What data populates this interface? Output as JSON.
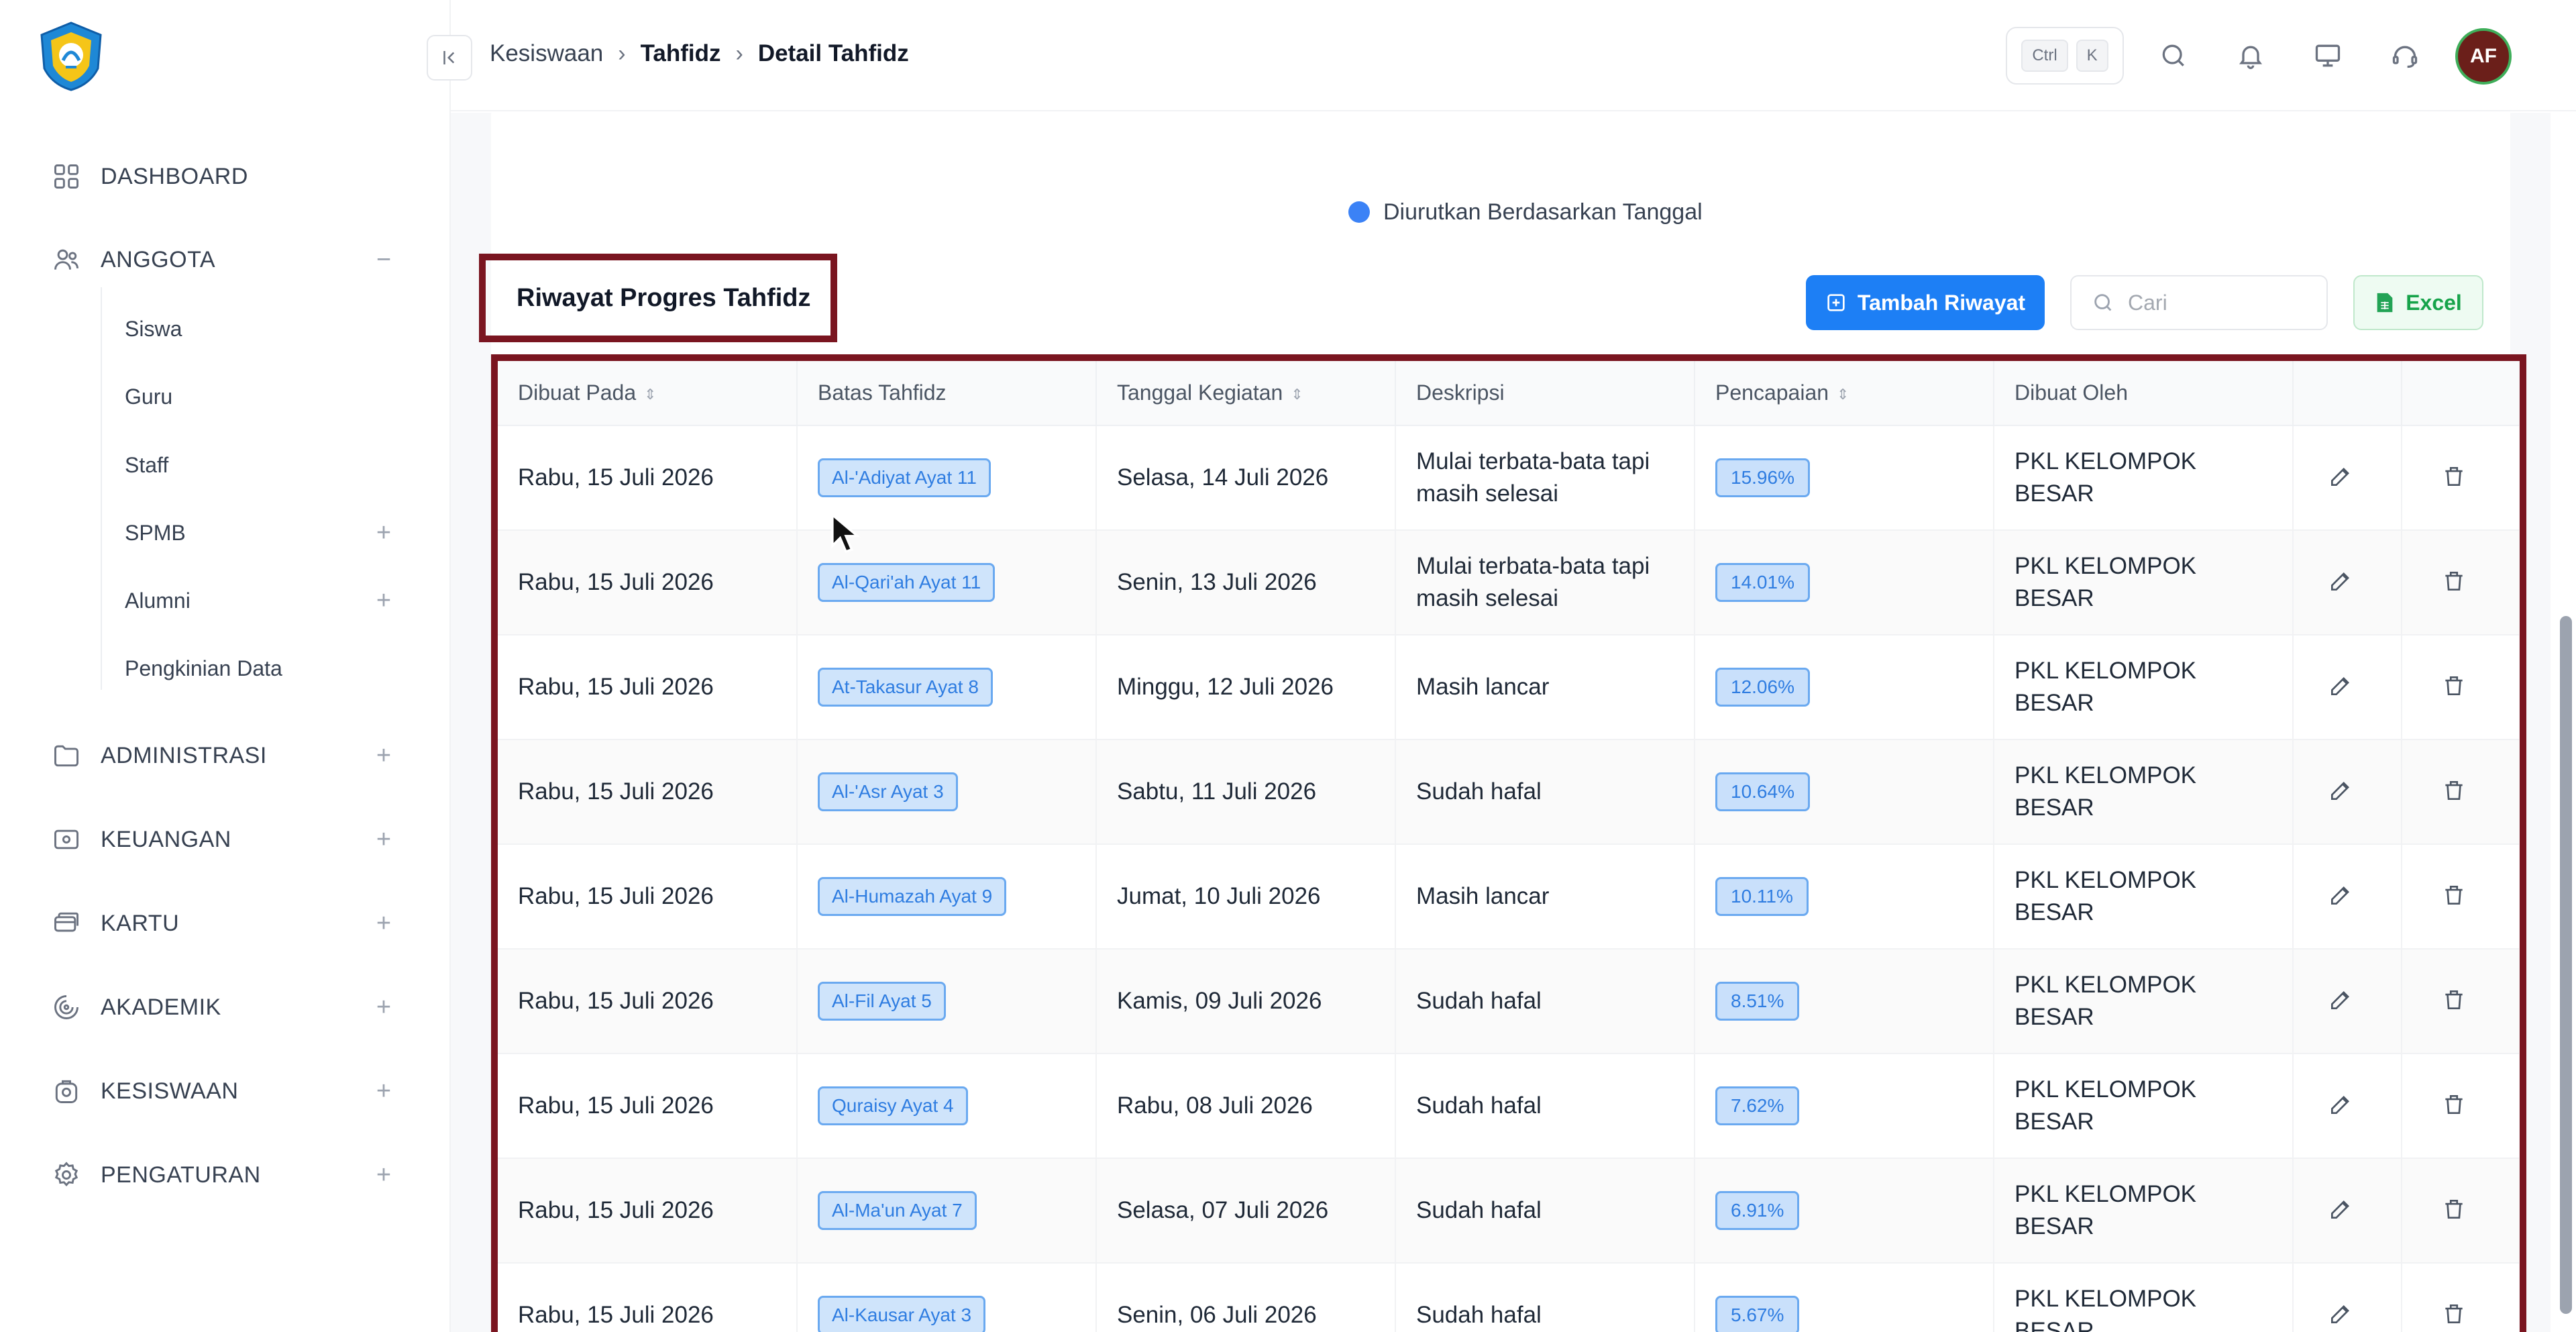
{
  "colors": {
    "accent": "#1d7ff5",
    "highlight_frame": "#7a1520",
    "excel_green": "#16a34a",
    "avatar_bg": "#6b1f1a"
  },
  "sidebar": {
    "items": [
      {
        "label": "DASHBOARD",
        "icon": "grid-icon"
      },
      {
        "label": "ANGGOTA",
        "icon": "users-icon",
        "toggle": "−"
      },
      {
        "label": "ADMINISTRASI",
        "icon": "folder-icon",
        "toggle": "+"
      },
      {
        "label": "KEUANGAN",
        "icon": "wallet-icon",
        "toggle": "+"
      },
      {
        "label": "KARTU",
        "icon": "card-icon",
        "toggle": "+"
      },
      {
        "label": "AKADEMIK",
        "icon": "academic-icon",
        "toggle": "+"
      },
      {
        "label": "KESISWAAN",
        "icon": "student-icon",
        "toggle": "+"
      },
      {
        "label": "PENGATURAN",
        "icon": "settings-icon",
        "toggle": "+"
      }
    ],
    "sub_items": [
      {
        "label": "Siswa"
      },
      {
        "label": "Guru"
      },
      {
        "label": "Staff"
      },
      {
        "label": "SPMB",
        "toggle": "+"
      },
      {
        "label": "Alumni",
        "toggle": "+"
      },
      {
        "label": "Pengkinian Data"
      }
    ]
  },
  "header": {
    "breadcrumb": [
      "Kesiswaan",
      "Tahfidz",
      "Detail Tahfidz"
    ],
    "kbd": [
      "Ctrl",
      "K"
    ],
    "avatar_initials": "AF"
  },
  "sort_note": "Diurutkan Berdasarkan Tanggal",
  "card": {
    "title": "Riwayat Progres Tahfidz",
    "add_button": "Tambah Riwayat",
    "search_placeholder": "Cari",
    "excel_button": "Excel"
  },
  "table": {
    "headers": [
      "Dibuat Pada",
      "Batas Tahfidz",
      "Tanggal Kegiatan",
      "Deskripsi",
      "Pencapaian",
      "Dibuat Oleh"
    ],
    "rows": [
      {
        "created": "Rabu, 15 Juli 2026",
        "limit": "Al-'Adiyat Ayat 11",
        "date": "Selasa, 14 Juli 2026",
        "desc": "Mulai terbata-bata tapi masih selesai",
        "pct": "15.96%",
        "by": "PKL KELOMPOK BESAR"
      },
      {
        "created": "Rabu, 15 Juli 2026",
        "limit": "Al-Qari'ah Ayat 11",
        "date": "Senin, 13 Juli 2026",
        "desc": "Mulai terbata-bata tapi masih selesai",
        "pct": "14.01%",
        "by": "PKL KELOMPOK BESAR"
      },
      {
        "created": "Rabu, 15 Juli 2026",
        "limit": "At-Takasur Ayat 8",
        "date": "Minggu, 12 Juli 2026",
        "desc": "Masih lancar",
        "pct": "12.06%",
        "by": "PKL KELOMPOK BESAR"
      },
      {
        "created": "Rabu, 15 Juli 2026",
        "limit": "Al-'Asr Ayat 3",
        "date": "Sabtu, 11 Juli 2026",
        "desc": "Sudah hafal",
        "pct": "10.64%",
        "by": "PKL KELOMPOK BESAR"
      },
      {
        "created": "Rabu, 15 Juli 2026",
        "limit": "Al-Humazah Ayat 9",
        "date": "Jumat, 10 Juli 2026",
        "desc": "Masih lancar",
        "pct": "10.11%",
        "by": "PKL KELOMPOK BESAR"
      },
      {
        "created": "Rabu, 15 Juli 2026",
        "limit": "Al-Fil Ayat 5",
        "date": "Kamis, 09 Juli 2026",
        "desc": "Sudah hafal",
        "pct": "8.51%",
        "by": "PKL KELOMPOK BESAR"
      },
      {
        "created": "Rabu, 15 Juli 2026",
        "limit": "Quraisy Ayat 4",
        "date": "Rabu, 08 Juli 2026",
        "desc": "Sudah hafal",
        "pct": "7.62%",
        "by": "PKL KELOMPOK BESAR"
      },
      {
        "created": "Rabu, 15 Juli 2026",
        "limit": "Al-Ma'un Ayat 7",
        "date": "Selasa, 07 Juli 2026",
        "desc": "Sudah hafal",
        "pct": "6.91%",
        "by": "PKL KELOMPOK BESAR"
      },
      {
        "created": "Rabu, 15 Juli 2026",
        "limit": "Al-Kausar Ayat 3",
        "date": "Senin, 06 Juli 2026",
        "desc": "Sudah hafal",
        "pct": "5.67%",
        "by": "PKL KELOMPOK BESAR"
      }
    ]
  }
}
